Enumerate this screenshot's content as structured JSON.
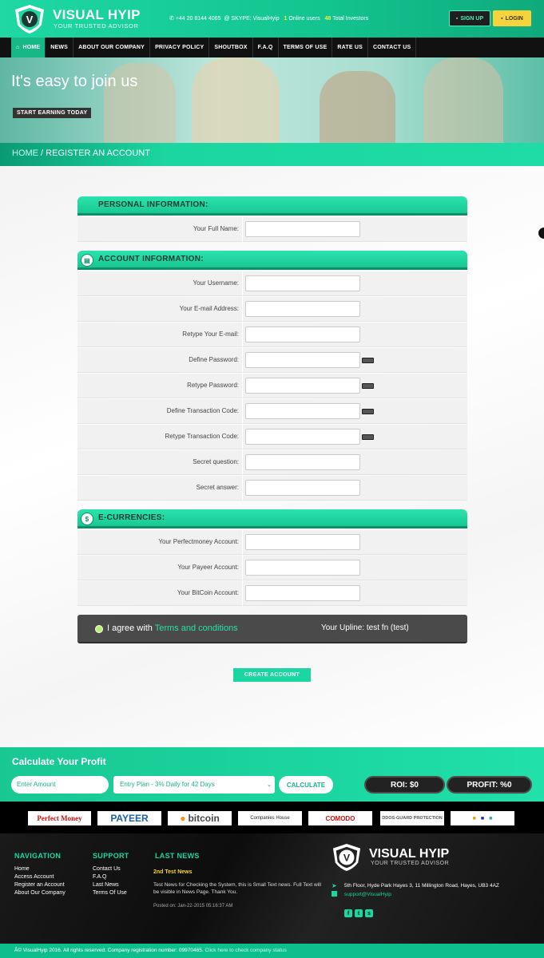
{
  "header": {
    "logo_title": "VISUAL HYIP",
    "logo_sub": "YOUR TRUSTED ADVISOR",
    "logo_letter": "V",
    "phone": "+44 20 8144 4065",
    "skype": "SKYPE: VisualHyip",
    "online_count": "1",
    "online_label": "Online users",
    "investors_count": "48",
    "investors_label": "Total Investors",
    "signup_label": "SIGN UP",
    "login_label": "LOGIN"
  },
  "nav": {
    "items": [
      "HOME",
      "NEWS",
      "ABOUT OUR COMPANY",
      "PRIVACY POLICY",
      "SHOUTBOX",
      "F.A.Q",
      "TERMS OF USE",
      "RATE US",
      "CONTACT US"
    ]
  },
  "hero": {
    "title": "It's easy to join us",
    "cta": "START EARNING TODAY"
  },
  "breadcrumb": {
    "home": "HOME",
    "sep": " / ",
    "current": "REGISTER AN ACCOUNT"
  },
  "form": {
    "personal": {
      "heading": "PERSONAL INFORMATION:",
      "fields": [
        "Your Full Name:"
      ]
    },
    "account": {
      "heading": "ACCOUNT INFORMATION:",
      "fields": [
        "Your Username:",
        "Your E-mail Address:",
        "Retype Your E-mail:",
        "Define Password:",
        "Retype Password:",
        "Define Transaction Code:",
        "Retype Transaction Code:",
        "Secret question:",
        "Secret answer:"
      ]
    },
    "currencies": {
      "heading": "E-CURRENCIES:",
      "fields": [
        "Your Perfectmoney Account:",
        "Your Payeer Account:",
        "Your BitCoin Account:"
      ]
    },
    "agree_prefix": "I agree with ",
    "agree_link": "Terms and conditions",
    "upline": "Your Upline: test fn (test)",
    "submit": "CREATE ACCOUNT"
  },
  "calculator": {
    "title": "Calculate Your Profit",
    "amount_placeholder": "Enter Amount",
    "plan": "Entry Plan - 3% Daily for 42 Days",
    "button": "CALCULATE",
    "roi": "ROI: $0",
    "profit": "PROFIT: %0"
  },
  "payments": {
    "perfectmoney": "Perfect Money",
    "payeer": "PAYEER",
    "bitcoin": "bitcoin",
    "companies_house": "Companies House",
    "comodo": "COMODO",
    "ddos": "DDOS-GUARD PROTECTION"
  },
  "footer": {
    "nav_heading": "NAVIGATION",
    "nav_links": [
      "Home",
      "Access Account",
      "Register an Account",
      "About Our Company"
    ],
    "support_heading": "SUPPORT",
    "support_links": [
      "Contact Us",
      "F.A.Q",
      "Last News",
      "Terms Of Use"
    ],
    "news_heading": "LAST NEWS",
    "news_title": "2nd Test News",
    "news_body": "Test News for Checking the System, this is Small Text news. Full Text will be visible in News Page. Thank You.",
    "news_date": "Posted on: Jan-22-2015 05:16:37 AM",
    "logo_title": "VISUAL HYIP",
    "logo_sub": "YOUR TRUSTED ADVISOR",
    "address": "5th Floor, Hyde Park Hayes 3, 11 Millington Road, Hayes, UB3 4AZ",
    "email": "support@VisualHyip",
    "copyright": "Â© VisualHyip 2016. All rights reserved. Company registration number: 09970465.",
    "copyright_link": "Click here to check company status"
  },
  "colors": {
    "accent": "#1ad6a0",
    "dark": "#111111",
    "gold": "#f6d33a"
  }
}
